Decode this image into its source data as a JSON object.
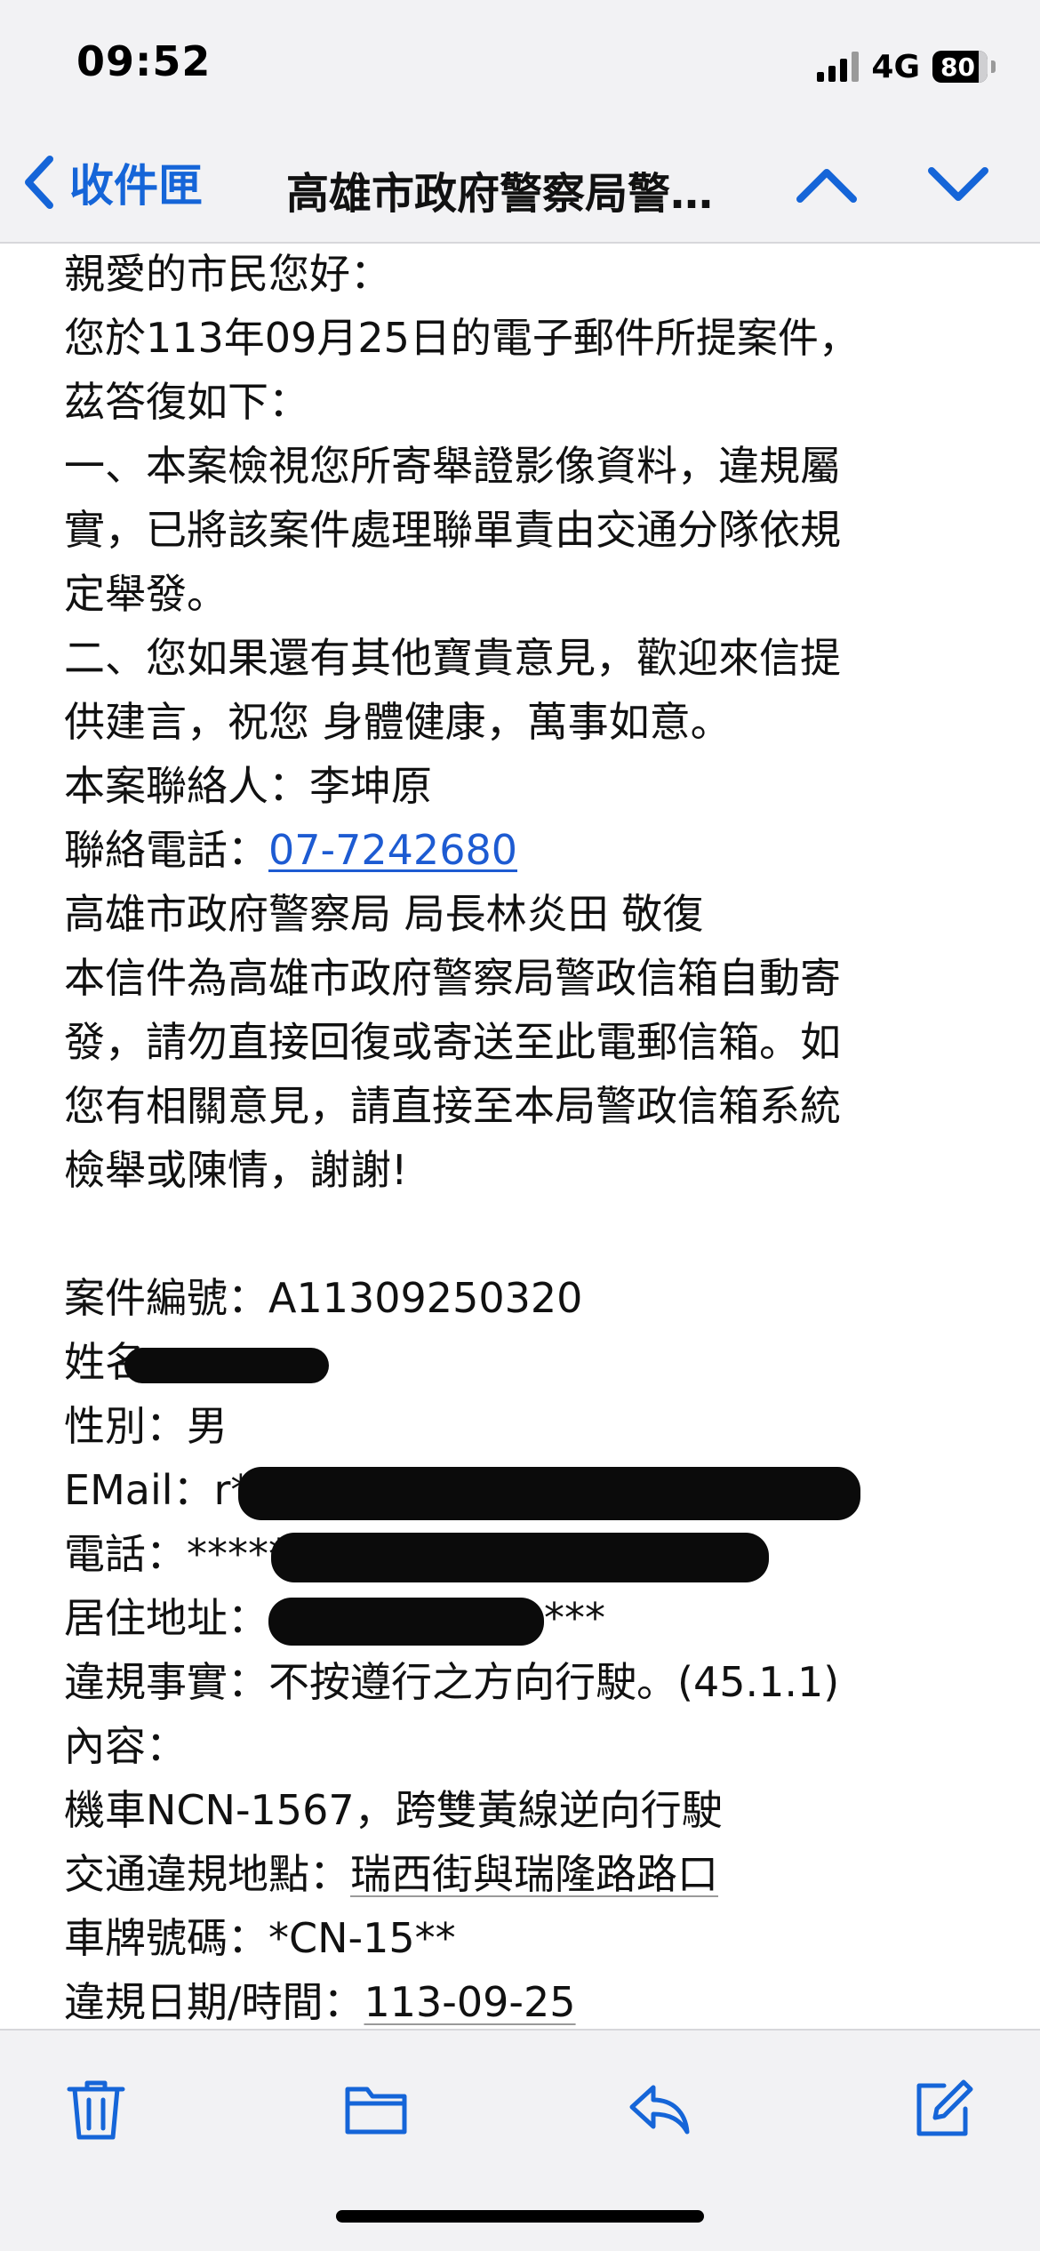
{
  "status_bar": {
    "time": "09:52",
    "network": "4G",
    "battery": "80"
  },
  "nav": {
    "back_label": "收件匣",
    "title": "高雄市政府警察局警政信箱自動回覆",
    "icons": {
      "back": "chevron-left-icon",
      "up": "chevron-up-icon",
      "down": "chevron-down-icon"
    }
  },
  "email": {
    "greeting": "親愛的市民您好：",
    "intro_1": "您於113年09月25日的電子郵件所提案件，",
    "intro_2": "茲答復如下：",
    "item1_line1": "一、本案檢視您所寄舉證影像資料，違規屬",
    "item1_line2": "實，已將該案件處理聯單責由交通分隊依規",
    "item1_line3": "定舉發。",
    "item2_line1": "二、您如果還有其他寶貴意見，歡迎來信提",
    "item2_line2": "供建言，祝您 身體健康，萬事如意。",
    "contact_label": "本案聯絡人：",
    "contact_name": "李坤原",
    "phone_label": "聯絡電話：",
    "phone_number": "07-7242680",
    "signature": "高雄市政府警察局 局長林炎田 敬復",
    "notice_1": "本信件為高雄市政府警察局警政信箱自動寄",
    "notice_2": "發，請勿直接回復或寄送至此電郵信箱。如",
    "notice_3": "您有相關意見，請直接至本局警政信箱系統",
    "notice_4": "檢舉或陳情，謝謝!",
    "case_label": "案件編號：",
    "case_number": "A11309250320",
    "name_label": "姓名：",
    "gender_label": "性別：",
    "gender": "男",
    "email_label": "EMail：",
    "email_prefix": "r***",
    "tel_label": "電話：",
    "tel_prefix": "*****",
    "address_label": "居住地址：",
    "address_suffix": "***",
    "violation_label": "違規事實：",
    "violation": "不按遵行之方向行駛。(45.1.1)",
    "content_label": "內容：",
    "content": "機車NCN-1567，跨雙黃線逆向行駛",
    "location_label": "交通違規地點：",
    "location": "瑞西街與瑞隆路路口",
    "plate_label": "車牌號碼：",
    "plate": "*CN-15**",
    "datetime_label": "違規日期/時間：",
    "datetime": "113-09-25"
  },
  "toolbar": {
    "icons": [
      "trash-icon",
      "folder-icon",
      "reply-icon",
      "compose-icon"
    ]
  },
  "colors": {
    "accent": "#1565d8",
    "bar_background": "#f2f2f4",
    "text": "#111111"
  }
}
